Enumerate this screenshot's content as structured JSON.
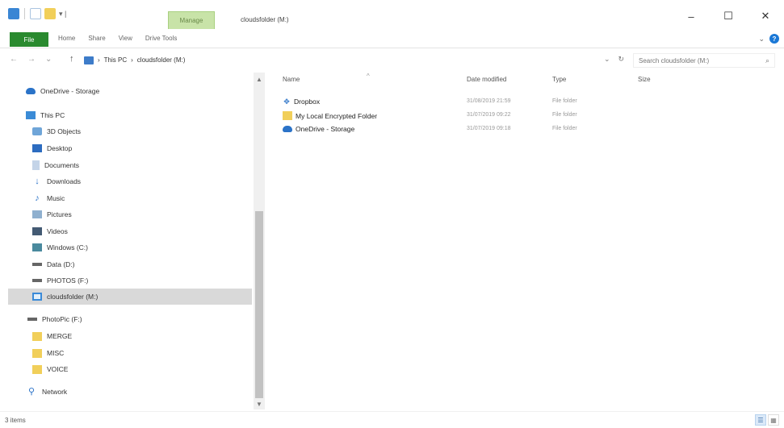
{
  "window": {
    "title": "cloudsfolder (M:)",
    "context_tab": "Manage",
    "controls": {
      "minimize": "–",
      "maximize": "☐",
      "close": "✕"
    }
  },
  "ribbon": {
    "file_tab": "File",
    "tabs": [
      "Home",
      "Share",
      "View",
      "Drive Tools"
    ]
  },
  "address": {
    "segments": [
      "This PC",
      "cloudsfolder (M:)"
    ],
    "search_placeholder": "Search cloudsfolder (M:)"
  },
  "nav_pane": {
    "items": [
      {
        "label": "OneDrive - Storage",
        "icon": "onedrive-cloud-icon"
      },
      {
        "label": "This PC",
        "icon": "this-pc-icon"
      },
      {
        "label": "3D Objects",
        "icon": "3d-objects-icon"
      },
      {
        "label": "Desktop",
        "icon": "desktop-icon"
      },
      {
        "label": "Documents",
        "icon": "documents-icon"
      },
      {
        "label": "Downloads",
        "icon": "downloads-icon"
      },
      {
        "label": "Music",
        "icon": "music-icon"
      },
      {
        "label": "Pictures",
        "icon": "pictures-icon"
      },
      {
        "label": "Videos",
        "icon": "videos-icon"
      },
      {
        "label": "Windows (C:)",
        "icon": "windows-drive-icon"
      },
      {
        "label": "Data (D:)",
        "icon": "disk-icon"
      },
      {
        "label": "PHOTOS (F:)",
        "icon": "disk-icon"
      },
      {
        "label": "cloudsfolder (M:)",
        "icon": "cloud-drive-icon"
      },
      {
        "label": "PhotoPic (F:)",
        "icon": "disk-icon"
      },
      {
        "label": "MERGE",
        "icon": "folder-icon"
      },
      {
        "label": "MISC",
        "icon": "folder-icon"
      },
      {
        "label": "VOICE",
        "icon": "folder-icon"
      },
      {
        "label": "Network",
        "icon": "network-icon"
      }
    ],
    "selected": "cloudsfolder (M:)"
  },
  "content": {
    "columns": [
      "Name",
      "Date modified",
      "Type",
      "Size"
    ],
    "rows": [
      {
        "name": "Dropbox",
        "icon": "dropbox-icon",
        "date": "31/08/2019 21:59",
        "type": "File folder"
      },
      {
        "name": "My Local Encrypted Folder",
        "icon": "folder-icon",
        "date": "31/07/2019 09:22",
        "type": "File folder"
      },
      {
        "name": "OneDrive - Storage",
        "icon": "onedrive-cloud-icon",
        "date": "31/07/2019 09:18",
        "type": "File folder"
      }
    ]
  },
  "status": {
    "text": "3 items"
  }
}
